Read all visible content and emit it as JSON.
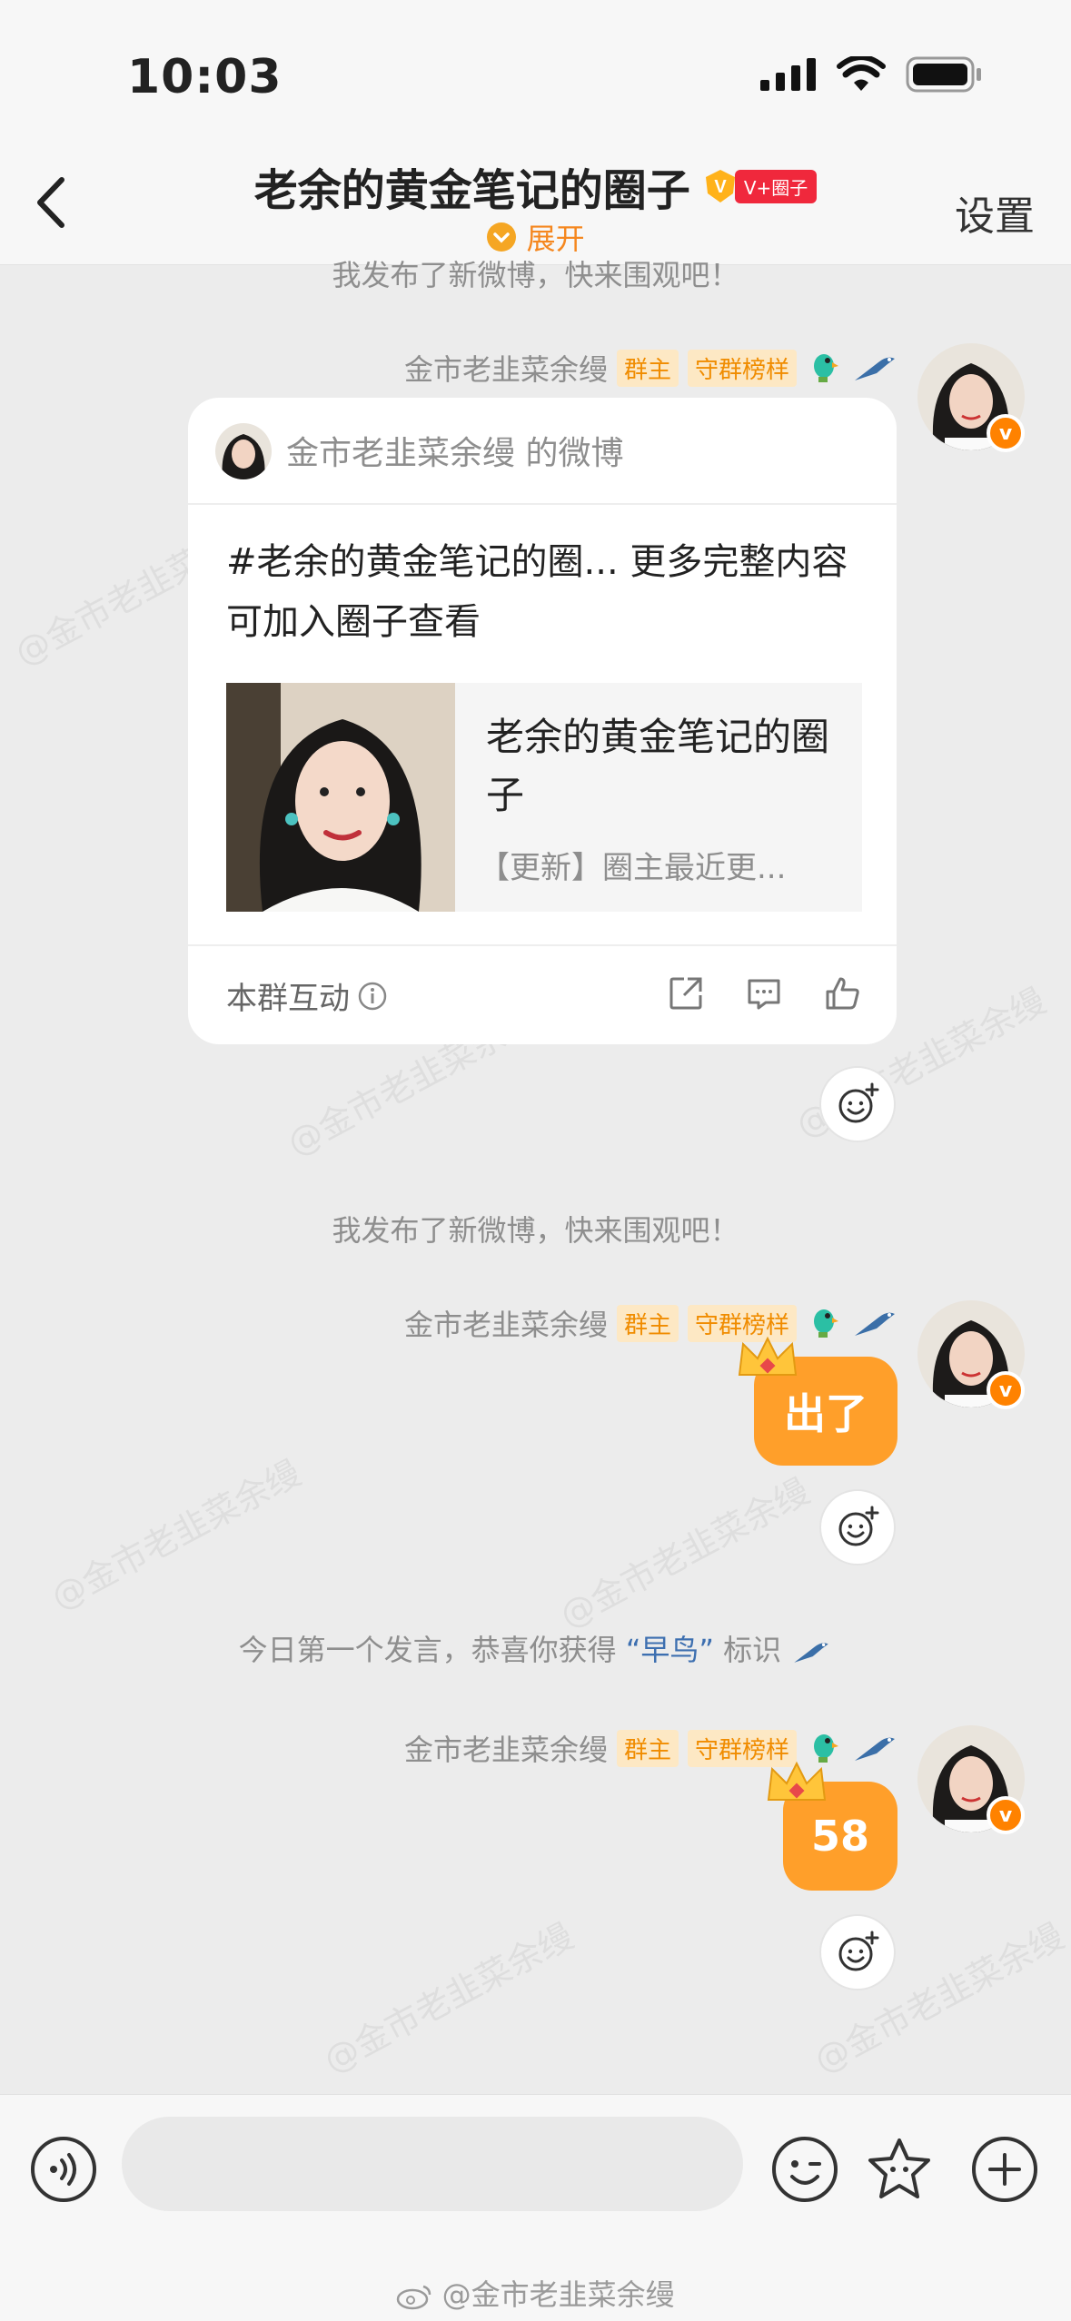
{
  "status": {
    "time": "10:03"
  },
  "nav": {
    "title": "老余的黄金笔记的圈子",
    "badge": "V+圈子",
    "expand": "展开",
    "settings": "设置"
  },
  "messages": {
    "system_top": "我发布了新微博，快来围观吧！",
    "system_mid": "我发布了新微博，快来围观吧！",
    "system_badge_prefix": "今日第一个发言，恭喜你获得",
    "system_badge_word": "“早鸟”",
    "system_badge_suffix": "标识"
  },
  "sender": {
    "name": "金市老韭菜余缦",
    "tag_owner": "群主",
    "tag_guard": "守群榜样"
  },
  "card": {
    "header": "金市老韭菜余缦 的微博",
    "text": "#老余的黄金笔记的圈... 更多完整内容可加入圈子查看",
    "link_title": "老余的黄金笔记的圈子",
    "link_sub": "【更新】圈主最近更...",
    "interact_label": "本群互动"
  },
  "bubbles": {
    "first": "出了",
    "second": "58"
  },
  "watermark": "@金市老韭菜余缦",
  "footer_watermark": "@金市老韭菜余缦",
  "colors": {
    "accent": "#ff9f2a",
    "brand_orange": "#f5871f",
    "badge_red": "#f0283c"
  }
}
